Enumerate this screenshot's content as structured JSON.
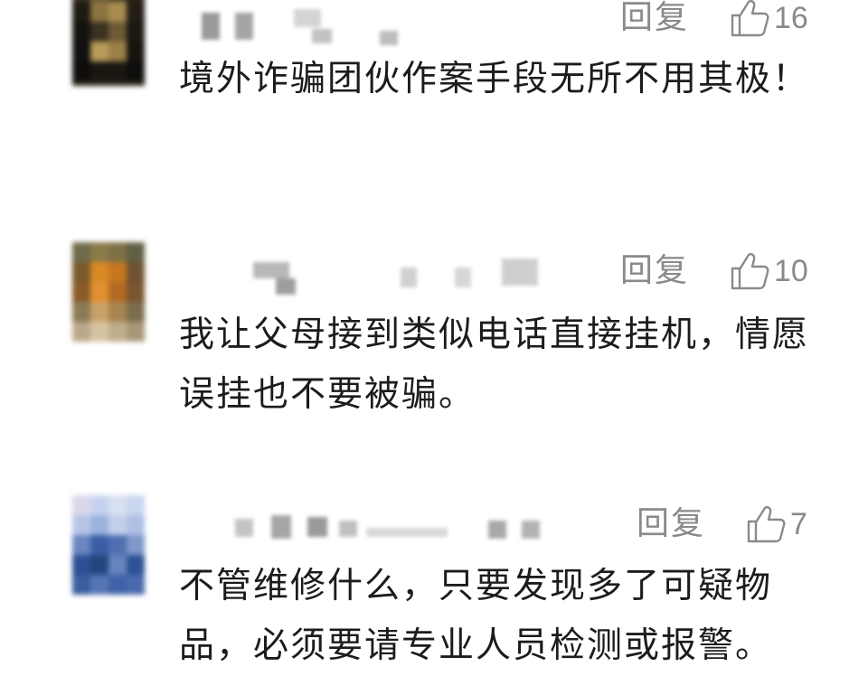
{
  "comments": [
    {
      "reply_label": "回复",
      "like_count": "16",
      "text": "境外诈骗团伙作案手段无所不用其极！"
    },
    {
      "reply_label": "回复",
      "like_count": "10",
      "text": "我让父母接到类似电话直接挂机，情愿误挂也不要被骗。"
    },
    {
      "reply_label": "回复",
      "like_count": "7",
      "text": "不管维修什么，只要发现多了可疑物品，必须要请专业人员检测或报警。"
    }
  ],
  "colors": {
    "text": "#1c1c1c",
    "muted": "#8a8a8a"
  },
  "icons": {
    "like": "thumbs-up-icon",
    "avatar": "blurred-avatar",
    "nickname": "blurred-nickname"
  }
}
